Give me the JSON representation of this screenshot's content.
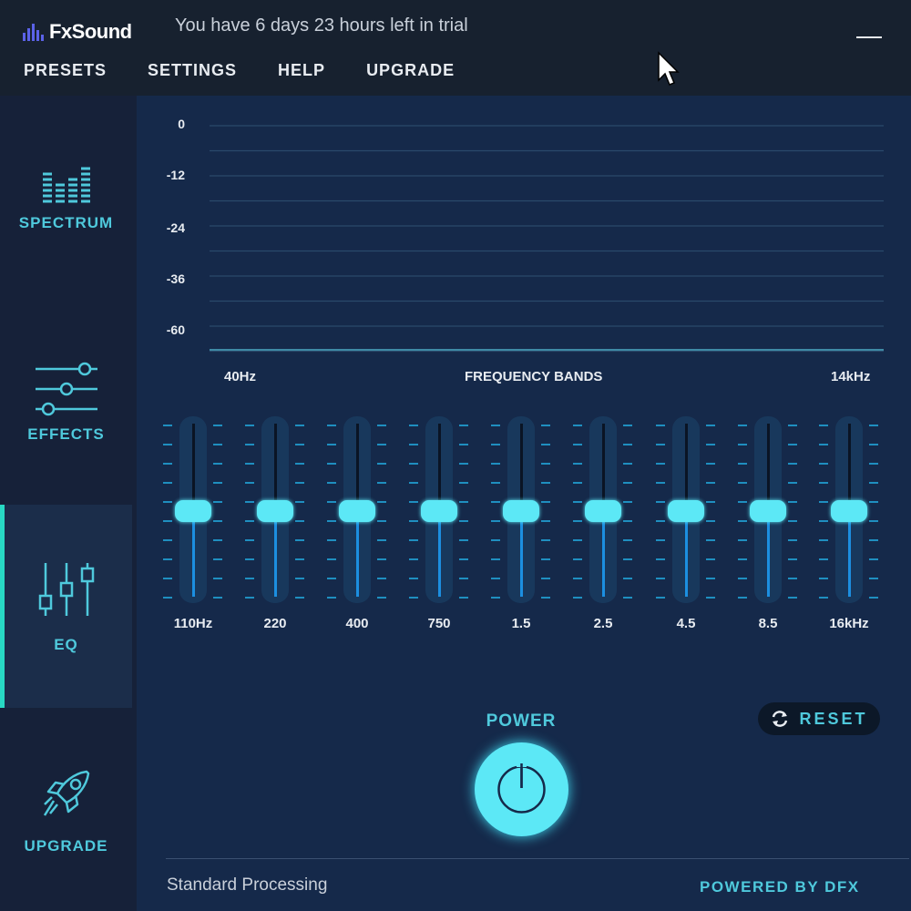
{
  "app": {
    "name": "FxSound",
    "trial_message": "You have 6 days 23 hours left in trial"
  },
  "menu": {
    "items": [
      "PRESETS",
      "SETTINGS",
      "HELP",
      "UPGRADE"
    ]
  },
  "sidebar": {
    "items": [
      {
        "label": "SPECTRUM",
        "icon": "spectrum-icon",
        "active": false
      },
      {
        "label": "EFFECTS",
        "icon": "effects-sliders-icon",
        "active": false
      },
      {
        "label": "EQ",
        "icon": "eq-icon",
        "active": true
      },
      {
        "label": "UPGRADE",
        "icon": "rocket-icon",
        "active": false
      }
    ]
  },
  "chart_data": {
    "type": "line",
    "title": "FREQUENCY BANDS",
    "y_ticks": [
      "0",
      "-12",
      "-24",
      "-36",
      "-60"
    ],
    "x_start_label": "40Hz",
    "x_end_label": "14kHz"
  },
  "eq": {
    "bands": [
      "110Hz",
      "220",
      "400",
      "750",
      "1.5",
      "2.5",
      "4.5",
      "8.5",
      "16kHz"
    ],
    "levels": [
      0,
      0,
      0,
      0,
      0,
      0,
      0,
      0,
      0
    ]
  },
  "power": {
    "label": "POWER"
  },
  "reset": {
    "label": "RESET"
  },
  "footer": {
    "status": "Standard Processing",
    "powered_by": "POWERED BY DFX"
  },
  "colors": {
    "accent": "#5ce8f6",
    "label": "#4fc9dc",
    "active_bar": "#28d9c4",
    "background": "#15294a"
  }
}
